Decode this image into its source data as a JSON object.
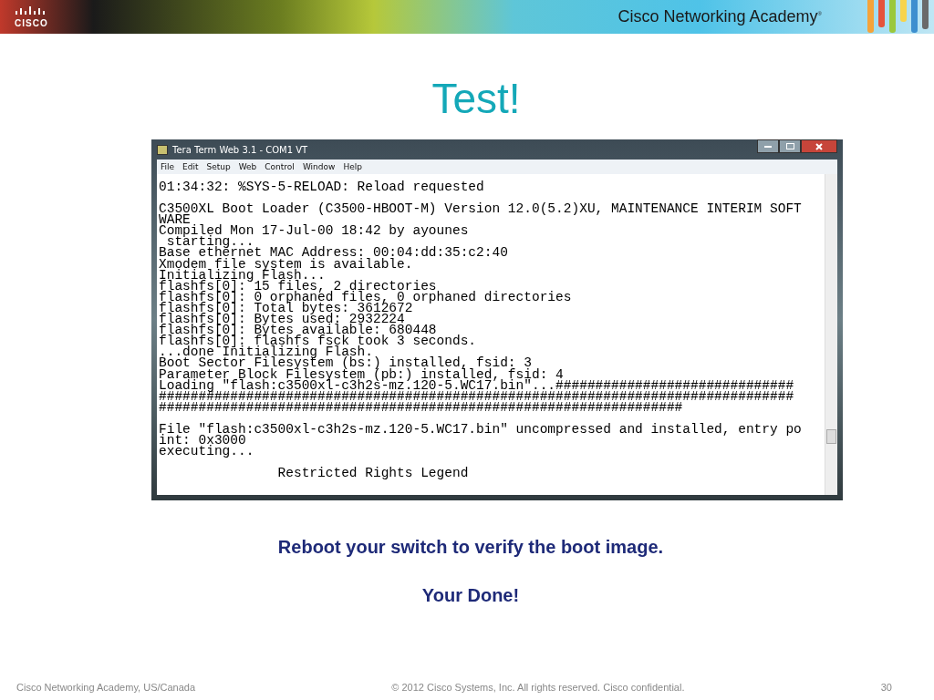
{
  "header": {
    "logo": "CISCO",
    "brand": "Cisco Networking Academy",
    "brand_mark": "®"
  },
  "slide": {
    "title": "Test!"
  },
  "terminal_window": {
    "title": "Tera Term Web 3.1 - COM1 VT",
    "menu": [
      {
        "label": "File"
      },
      {
        "label": "Edit"
      },
      {
        "label": "Setup"
      },
      {
        "label": "Web"
      },
      {
        "label": "Control"
      },
      {
        "label": "Window"
      },
      {
        "label": "Help"
      }
    ],
    "lines": [
      {
        "text": "01:34:32: %SYS-5-RELOAD: Reload requested",
        "gap_before": false
      },
      {
        "text": "C3500XL Boot Loader (C3500-HBOOT-M) Version 12.0(5.2)XU, MAINTENANCE INTERIM SOFT",
        "gap_before": true
      },
      {
        "text": "WARE",
        "gap_before": false
      },
      {
        "text": "Compiled Mon 17-Jul-00 18:42 by ayounes",
        "gap_before": false
      },
      {
        "text": " starting...",
        "gap_before": false
      },
      {
        "text": "Base ethernet MAC Address: 00:04:dd:35:c2:40",
        "gap_before": false
      },
      {
        "text": "Xmodem file system is available.",
        "gap_before": false
      },
      {
        "text": "Initializing Flash...",
        "gap_before": false
      },
      {
        "text": "flashfs[0]: 15 files, 2 directories",
        "gap_before": false
      },
      {
        "text": "flashfs[0]: 0 orphaned files, 0 orphaned directories",
        "gap_before": false
      },
      {
        "text": "flashfs[0]: Total bytes: 3612672",
        "gap_before": false
      },
      {
        "text": "flashfs[0]: Bytes used: 2932224",
        "gap_before": false
      },
      {
        "text": "flashfs[0]: Bytes available: 680448",
        "gap_before": false
      },
      {
        "text": "flashfs[0]: flashfs fsck took 3 seconds.",
        "gap_before": false
      },
      {
        "text": "...done Initializing Flash.",
        "gap_before": false
      },
      {
        "text": "Boot Sector Filesystem (bs:) installed, fsid: 3",
        "gap_before": false
      },
      {
        "text": "Parameter Block Filesystem (pb:) installed, fsid: 4",
        "gap_before": false
      },
      {
        "text": "Loading \"flash:c3500xl-c3h2s-mz.120-5.WC17.bin\"...##############################",
        "gap_before": false
      },
      {
        "text": "################################################################################",
        "gap_before": false
      },
      {
        "text": "##################################################################",
        "gap_before": false
      },
      {
        "text": "File \"flash:c3500xl-c3h2s-mz.120-5.WC17.bin\" uncompressed and installed, entry po",
        "gap_before": true
      },
      {
        "text": "int: 0x3000",
        "gap_before": false
      },
      {
        "text": "executing...",
        "gap_before": false
      },
      {
        "text": "               Restricted Rights Legend",
        "gap_before": true
      }
    ]
  },
  "notes": [
    {
      "text": "Reboot your switch to verify the boot image."
    },
    {
      "text": "Your Done!"
    }
  ],
  "footer": {
    "left": "Cisco Networking Academy, US/Canada",
    "center": "© 2012 Cisco Systems, Inc. All rights reserved. Cisco confidential.",
    "page": "30"
  }
}
